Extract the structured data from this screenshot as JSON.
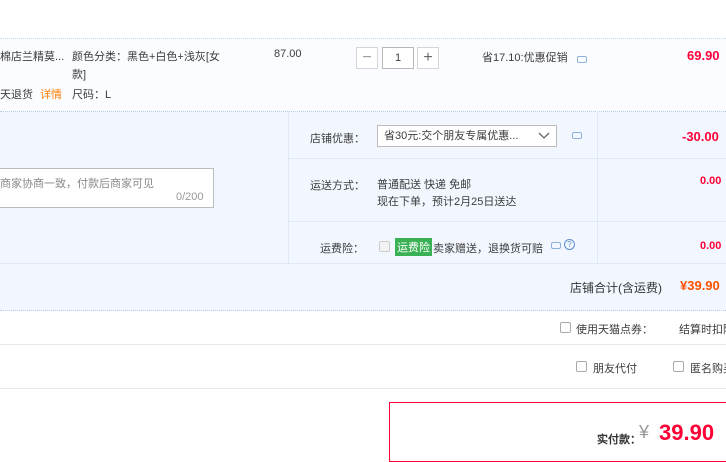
{
  "item": {
    "title_fragment": "棉店兰精莫...",
    "return_fragment": "天退货",
    "details_link": "详情",
    "sku_color_line1": "颜色分类：黑色+白色+浅灰[女",
    "sku_color_line2": "款]",
    "sku_size": "尺码：L",
    "unit_price": "87.00",
    "quantity_value": "1",
    "minus_symbol": "−",
    "plus_symbol": "+",
    "promo_text": "省17.10:优惠促销",
    "subtotal": "69.90"
  },
  "shop_discount": {
    "label": "店铺优惠：",
    "selected_option": "省30元:交个朋友专属优惠...",
    "amount": "-30.00"
  },
  "message": {
    "placeholder": "商家协商一致，付款后商家可见",
    "counter": "0/200"
  },
  "shipping": {
    "label": "运送方式：",
    "method": "普通配送 快递 免邮",
    "estimate": "现在下单，预计2月25日送达",
    "amount": "0.00"
  },
  "insurance": {
    "label": "运费险：",
    "badge": "运费险",
    "text": "卖家赠送，退换货可赔",
    "amount": "0.00",
    "help_symbol": "?"
  },
  "shop_total": {
    "label": "店铺合计(含运费)",
    "amount": "¥39.90"
  },
  "tmall_points": {
    "label": "使用天猫点券：",
    "right_text": "结算时扣除"
  },
  "options": {
    "friend_pay": "朋友代付",
    "anonymous": "匿名购买"
  },
  "payment": {
    "label": "实付款：",
    "currency": "¥",
    "amount": "39.90"
  },
  "colors": {
    "accent_red": "#ff0036",
    "total_orange": "#ff5000",
    "link_orange": "#ff7d00",
    "badge_green": "#3ab154",
    "panel_bg": "#f2f7ff"
  }
}
